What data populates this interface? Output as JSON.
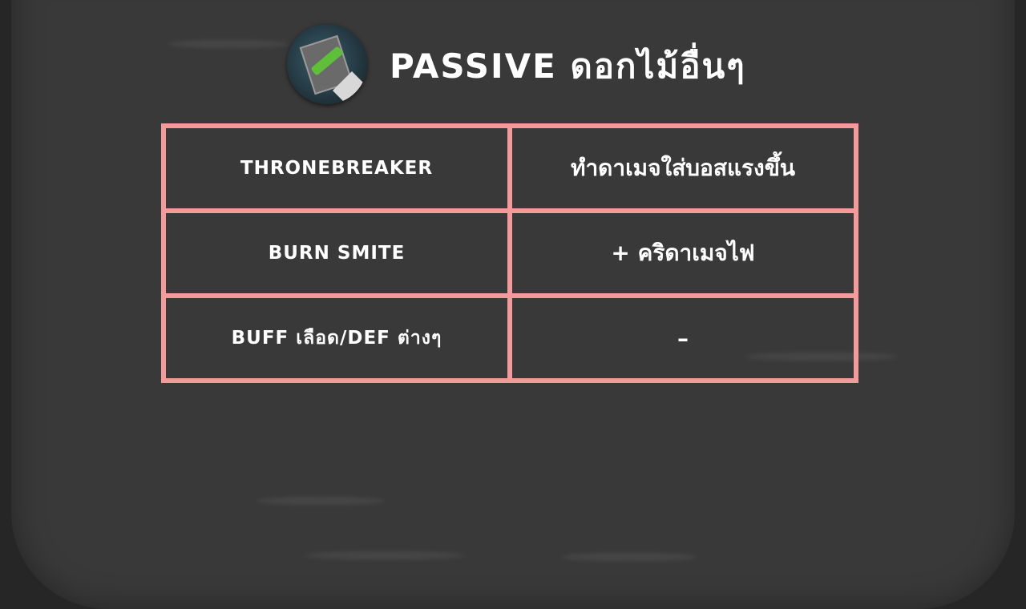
{
  "title": "PASSIVE ดอกไม้อื่นๆ",
  "badge_icon": "sticker-box-icon",
  "rows": [
    {
      "name": "THRONEBREAKER",
      "effect": "ทำดาเมจใส่บอสแรงขึ้น"
    },
    {
      "name": "BURN SMITE",
      "effect": "+ คริดาเมจไฟ"
    },
    {
      "name": "BUFF เลือด/DEF ต่างๆ",
      "effect": "–"
    }
  ],
  "colors": {
    "background": "#393939",
    "table_border": "#f49a9a",
    "text": "#ffffff"
  }
}
